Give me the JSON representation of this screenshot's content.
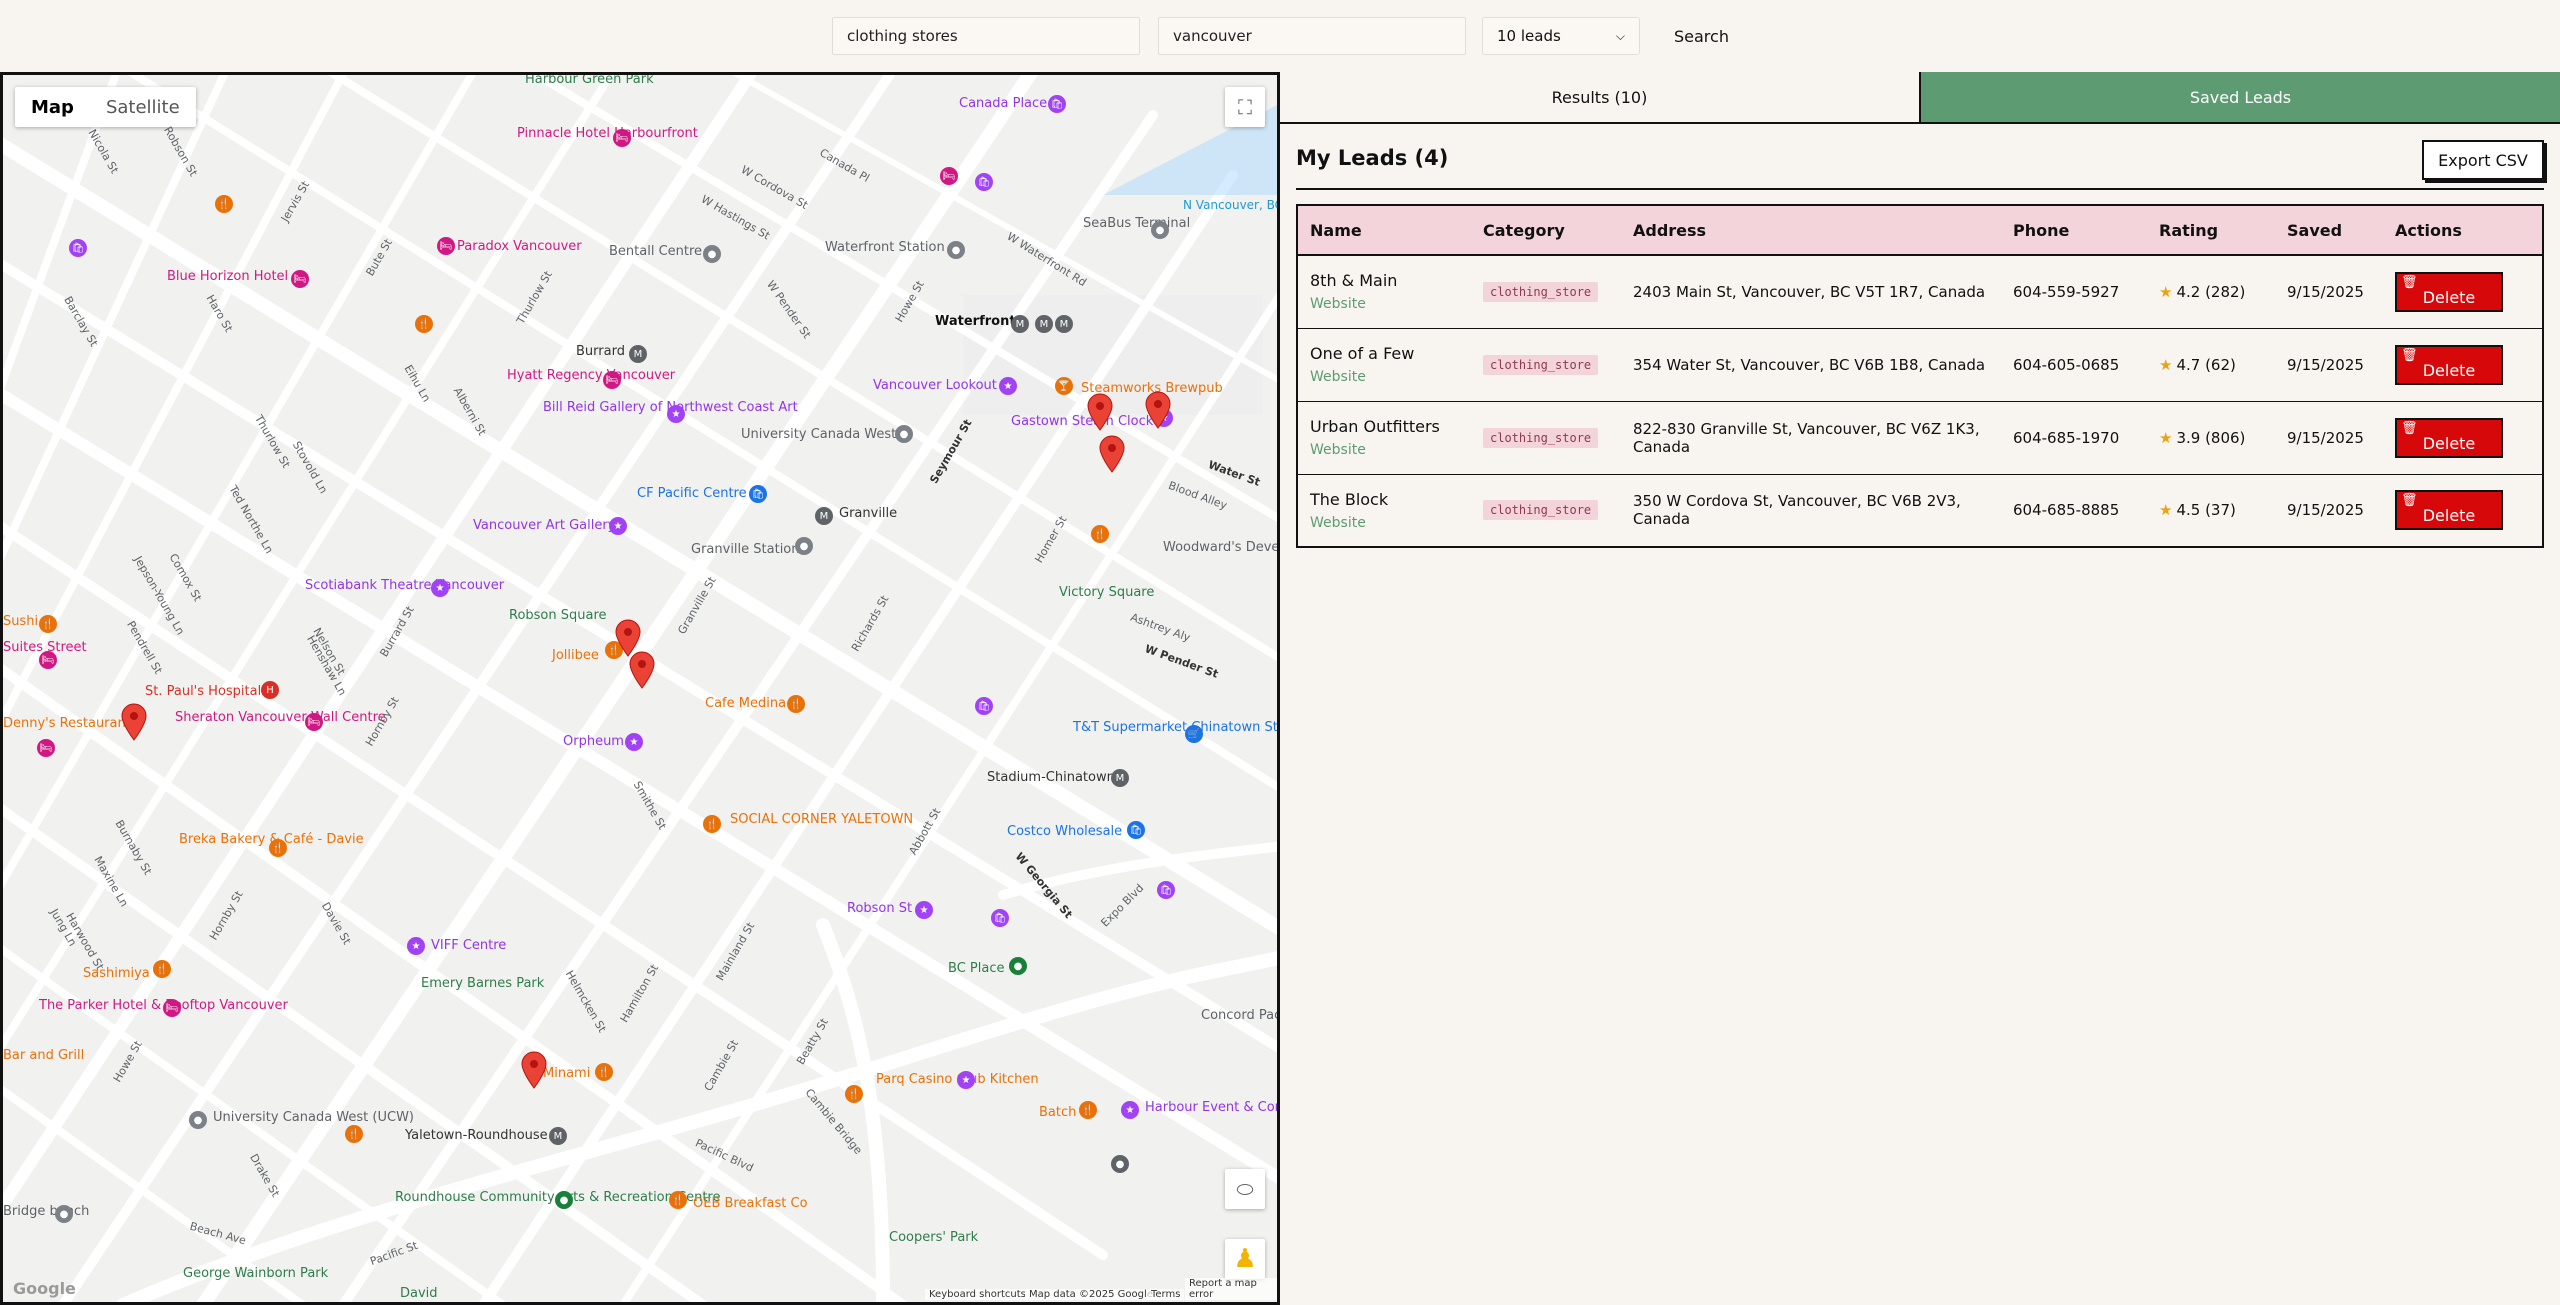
{
  "search": {
    "query": "clothing stores",
    "location": "vancouver",
    "limit_selected": "10 leads",
    "button": "Search"
  },
  "map": {
    "toggle": {
      "map": "Map",
      "satellite": "Satellite"
    },
    "attribution": {
      "logo": "Google",
      "shortcuts": "Keyboard shortcuts",
      "data": "Map data ©2025 Google",
      "terms": "Terms",
      "report": "Report a map error"
    },
    "places": [
      "Harbour Green Park",
      "Canada Place",
      "Pinnacle Hotel Harbourfront",
      "Paradox Vancouver",
      "Bentall Centre",
      "Waterfront Station",
      "Waterfront",
      "SeaBus Terminal",
      "N Vancouver, BC",
      "Blue Horizon Hotel",
      "Burrard",
      "Hyatt Regency Vancouver",
      "Bill Reid Gallery of Northwest Coast Art",
      "University Canada West",
      "Vancouver Lookout",
      "Steamworks Brewpub",
      "Gastown Steam Clock",
      "CF Pacific Centre",
      "Granville",
      "Vancouver Art Gallery",
      "Granville Station",
      "Woodward's Development",
      "Scotiabank Theatre Vancouver",
      "Robson Square",
      "Victory Square",
      "Jollibee",
      "St. Paul's Hospital",
      "Sheraton Vancouver Wall Centre",
      "Cafe Medina",
      "T&T Supermarket Chinatown Store",
      "Orpheum",
      "Stadium-Chinatown",
      "SOCIAL CORNER YALETOWN",
      "Costco Wholesale",
      "Breka Bakery & Café - Davie",
      "Robson St",
      "VIFF Centre",
      "BC Place",
      "Emery Barnes Park",
      "Sashimiya",
      "The Parker Hotel & Rooftop Vancouver",
      "Concord Pacific Vancouver",
      "Minami",
      "Parq Casino Club Kitchen",
      "Batch",
      "Harbour Event & Convention Centre",
      "University Canada West (UCW)",
      "Yaletown-Roundhouse",
      "Roundhouse Community Arts & Recreation Centre",
      "OEB Breakfast Co",
      "Coopers' Park",
      "George Wainborn Park",
      "David",
      "Sushi",
      "Suites Street",
      "Denny's Restaurant",
      "Bar and Grill",
      "Bridge bench"
    ],
    "streets": [
      "Robson St",
      "Nicola St",
      "Jervis St",
      "Bute St",
      "Thurlow St",
      "W Cordova St",
      "W Hastings St",
      "Canada Pl",
      "W Waterfront Rd",
      "Howe St",
      "W Pender St",
      "Seymour St",
      "Water St",
      "Blood Alley",
      "Homer St",
      "Richards St",
      "Granville St",
      "Hornby St",
      "Burrard St",
      "Nelson St",
      "Smithe St",
      "Davie St",
      "Drake St",
      "Pacific St",
      "Pacific Blvd",
      "Cambie St",
      "Beatty St",
      "Hamilton St",
      "Mainland St",
      "Helmcken St",
      "Cambie Bridge",
      "Expo Blvd",
      "W Georgia St",
      "Abbott St",
      "Beach Ave",
      "Burnaby St",
      "Harwood St",
      "Comox St",
      "Pendrell St",
      "Haro St",
      "Barclay St",
      "Ted Northe Ln",
      "Jepson-Young Ln",
      "Henshaw Ln",
      "Eihu Ln",
      "Alberni St",
      "Stovold Ln",
      "Ashtrey Aly",
      "Jung Ln",
      "Maxine Ln",
      "W Pender St",
      "Hornby St",
      "Thurlow St",
      "Howe St"
    ]
  },
  "panel": {
    "tabs": {
      "results": "Results (10)",
      "saved": "Saved Leads"
    },
    "title": "My Leads (4)",
    "export_button": "Export CSV",
    "columns": [
      "Name",
      "Category",
      "Address",
      "Phone",
      "Rating",
      "Saved",
      "Actions"
    ],
    "rows": [
      {
        "name": "8th & Main",
        "website": "Website",
        "category": "clothing_store",
        "address": "2403 Main St, Vancouver, BC V5T 1R7, Canada",
        "phone": "604-559-5927",
        "rating": "4.2 (282)",
        "saved": "9/15/2025",
        "action": "Delete"
      },
      {
        "name": "One of a Few",
        "website": "Website",
        "category": "clothing_store",
        "address": "354 Water St, Vancouver, BC V6B 1B8, Canada",
        "phone": "604-605-0685",
        "rating": "4.7 (62)",
        "saved": "9/15/2025",
        "action": "Delete"
      },
      {
        "name": "Urban Outfitters",
        "website": "Website",
        "category": "clothing_store",
        "address": "822-830 Granville St, Vancouver, BC V6Z 1K3, Canada",
        "phone": "604-685-1970",
        "rating": "3.9 (806)",
        "saved": "9/15/2025",
        "action": "Delete"
      },
      {
        "name": "The Block",
        "website": "Website",
        "category": "clothing_store",
        "address": "350 W Cordova St, Vancouver, BC V6B 2V3, Canada",
        "phone": "604-685-8885",
        "rating": "4.5 (37)",
        "saved": "9/15/2025",
        "action": "Delete"
      }
    ]
  },
  "colors": {
    "background": "#f8f4ef",
    "saved_tab": "#5d9c72",
    "header_pink": "#f3d4da",
    "delete_red": "#d7080a",
    "star": "#e8a317",
    "pin_red": "#ea4335"
  }
}
